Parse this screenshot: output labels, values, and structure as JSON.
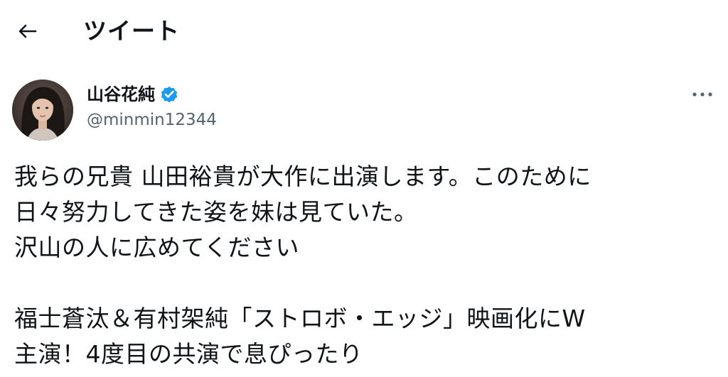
{
  "header": {
    "title": "ツイート"
  },
  "tweet": {
    "author": {
      "display_name": "山谷花純",
      "handle": "@minmin12344",
      "verified": true
    },
    "paragraph1": [
      "我らの兄貴 山田裕貴が大作に出演します。このために",
      "日々努力してきた姿を妹は見ていた。",
      "沢山の人に広めてください"
    ],
    "paragraph2": [
      "福士蒼汰＆有村架純「ストロボ・エッジ」映画化にW",
      "主演！4度目の共演で息ぴったり"
    ]
  },
  "colors": {
    "text": "#0f1419",
    "secondary_text": "#536471",
    "verified_blue": "#1d9bf0",
    "background": "#ffffff"
  },
  "icons": {
    "back": "arrow-left-icon",
    "verified": "verified-badge-icon",
    "more": "more-horizontal-icon"
  }
}
